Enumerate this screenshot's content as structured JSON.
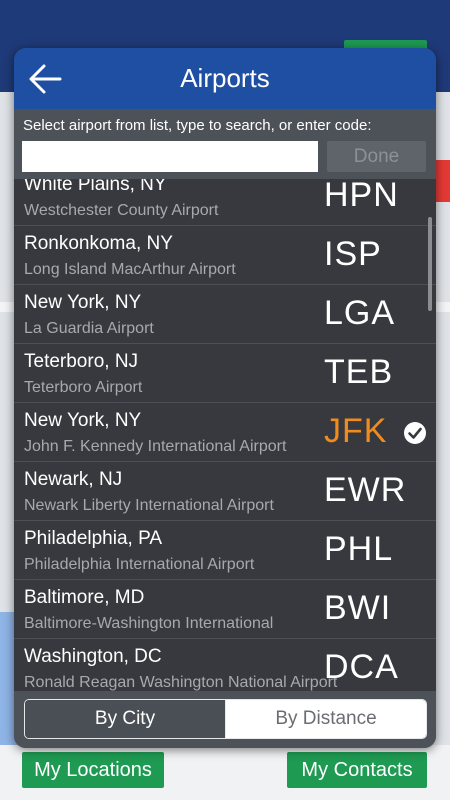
{
  "background": {
    "buttons": {
      "left": "My Locations",
      "right": "My Contacts"
    }
  },
  "modal": {
    "title": "Airports",
    "prompt": "Select airport from list, type to search, or enter code:",
    "search": {
      "value": "",
      "placeholder": ""
    },
    "done_label": "Done",
    "airports": [
      {
        "city": "White Plains, NY",
        "name": "Westchester County Airport",
        "code": "HPN",
        "selected": false
      },
      {
        "city": "Ronkonkoma, NY",
        "name": "Long Island MacArthur Airport",
        "code": "ISP",
        "selected": false
      },
      {
        "city": "New York, NY",
        "name": "La Guardia Airport",
        "code": "LGA",
        "selected": false
      },
      {
        "city": "Teterboro, NJ",
        "name": "Teterboro Airport",
        "code": "TEB",
        "selected": false
      },
      {
        "city": "New York, NY",
        "name": "John F. Kennedy International Airport",
        "code": "JFK",
        "selected": true
      },
      {
        "city": "Newark, NJ",
        "name": "Newark Liberty International Airport",
        "code": "EWR",
        "selected": false
      },
      {
        "city": "Philadelphia, PA",
        "name": "Philadelphia International Airport",
        "code": "PHL",
        "selected": false
      },
      {
        "city": "Baltimore, MD",
        "name": "Baltimore-Washington International",
        "code": "BWI",
        "selected": false
      },
      {
        "city": "Washington, DC",
        "name": "Ronald Reagan Washington National Airport",
        "code": "DCA",
        "selected": false
      }
    ],
    "sort": {
      "by_city": "By City",
      "by_distance": "By Distance",
      "active": "by_city"
    }
  },
  "colors": {
    "header": "#1f4fa3",
    "selected_code": "#f08c1e",
    "green_button": "#1e9a52"
  },
  "icons": {
    "back": "arrow-left-icon",
    "check": "checkmark-circle-icon"
  }
}
